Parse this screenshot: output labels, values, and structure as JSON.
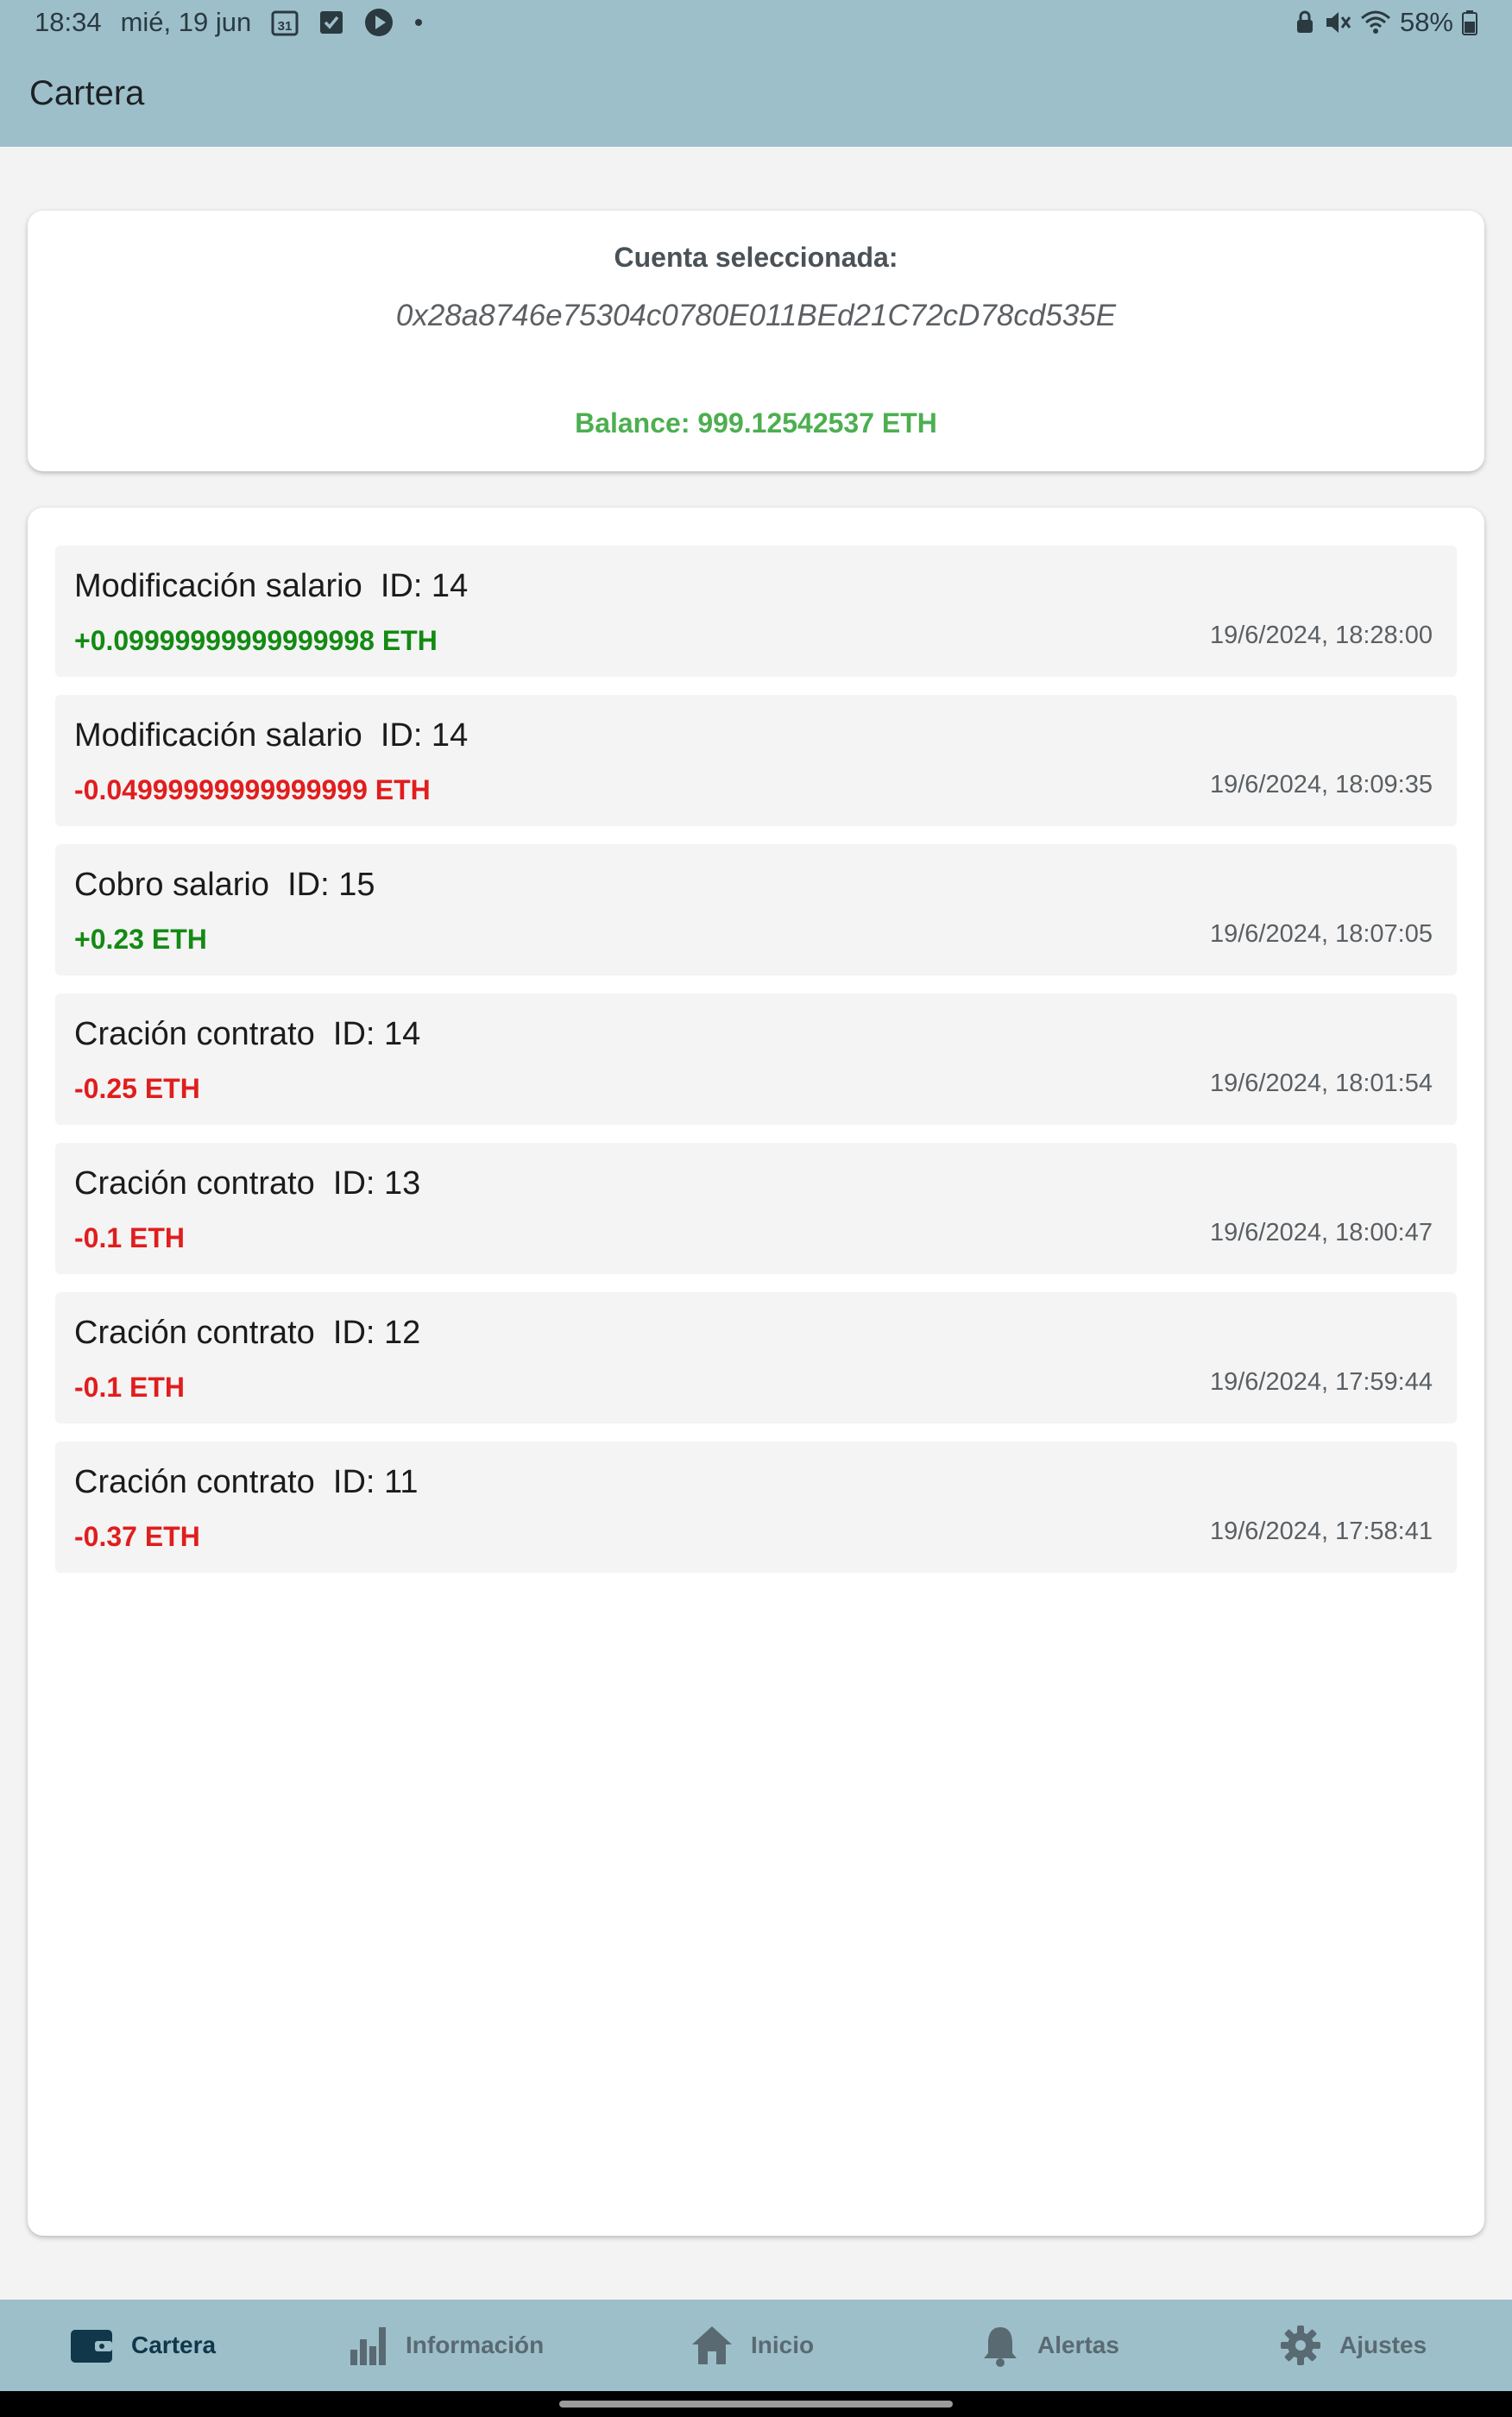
{
  "status_bar": {
    "time": "18:34",
    "date": "mié, 19 jun",
    "battery": "58%",
    "calendar_icon_text": "31",
    "icons": [
      "calendar-icon",
      "checkbox-icon",
      "play-icon",
      "dot-icon",
      "lock-icon",
      "mute-icon",
      "wifi-icon",
      "battery-icon"
    ]
  },
  "app_bar": {
    "title": "Cartera"
  },
  "account": {
    "label": "Cuenta seleccionada:",
    "address": "0x28a8746e75304c0780E011BEd21C72cD78cd535E",
    "balance": "Balance: 999.12542537 ETH"
  },
  "transactions": [
    {
      "title": "Modificación salario  ID: 14",
      "amount": "+0.09999999999999998 ETH",
      "direction": "positive",
      "date": "19/6/2024, 18:28:00"
    },
    {
      "title": "Modificación salario  ID: 14",
      "amount": "-0.04999999999999999 ETH",
      "direction": "negative",
      "date": "19/6/2024, 18:09:35"
    },
    {
      "title": "Cobro salario  ID: 15",
      "amount": "+0.23 ETH",
      "direction": "positive",
      "date": "19/6/2024, 18:07:05"
    },
    {
      "title": "Cración contrato  ID: 14",
      "amount": "-0.25 ETH",
      "direction": "negative",
      "date": "19/6/2024, 18:01:54"
    },
    {
      "title": "Cración contrato  ID: 13",
      "amount": "-0.1 ETH",
      "direction": "negative",
      "date": "19/6/2024, 18:00:47"
    },
    {
      "title": "Cración contrato  ID: 12",
      "amount": "-0.1 ETH",
      "direction": "negative",
      "date": "19/6/2024, 17:59:44"
    },
    {
      "title": "Cración contrato  ID: 11",
      "amount": "-0.37 ETH",
      "direction": "negative",
      "date": "19/6/2024, 17:58:41"
    }
  ],
  "bottom_nav": {
    "items": [
      {
        "label": "Cartera",
        "icon": "wallet-icon",
        "active": true
      },
      {
        "label": "Información",
        "icon": "bar-chart-icon",
        "active": false
      },
      {
        "label": "Inicio",
        "icon": "home-icon",
        "active": false
      },
      {
        "label": "Alertas",
        "icon": "bell-icon",
        "active": false
      },
      {
        "label": "Ajustes",
        "icon": "gear-icon",
        "active": false
      }
    ]
  },
  "colors": {
    "bar": "#9dbfca",
    "positive": "#138a13",
    "negative": "#e11d1d",
    "balance": "#4caf50",
    "nav_active": "#10384a"
  }
}
